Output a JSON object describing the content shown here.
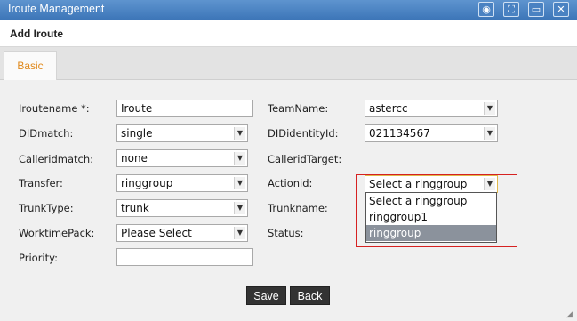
{
  "window": {
    "title": "Iroute Management",
    "buttons": [
      "◉",
      "⛶",
      "▭",
      "✕"
    ]
  },
  "header": {
    "title": "Add Iroute"
  },
  "tabs": [
    {
      "label": "Basic"
    }
  ],
  "form": {
    "left": [
      {
        "label": "Iroutename *:",
        "value": "Iroute",
        "type": "text"
      },
      {
        "label": "DIDmatch:",
        "value": "single",
        "type": "select"
      },
      {
        "label": "Calleridmatch:",
        "value": "none",
        "type": "select"
      },
      {
        "label": "Transfer:",
        "value": "ringgroup",
        "type": "select"
      },
      {
        "label": "TrunkType:",
        "value": "trunk",
        "type": "select"
      },
      {
        "label": "WorktimePack:",
        "value": "Please Select",
        "type": "select"
      },
      {
        "label": "Priority:",
        "value": "",
        "type": "text"
      }
    ],
    "right": [
      {
        "label": "TeamName:",
        "value": "astercc",
        "type": "select"
      },
      {
        "label": "DIDidentityId:",
        "value": "021134567",
        "type": "select"
      },
      {
        "label": "CalleridTarget:",
        "value": "",
        "type": "none"
      },
      {
        "label": "Actionid:",
        "value": "Select a ringgroup",
        "type": "select-open"
      },
      {
        "label": "Trunkname:",
        "value": "",
        "type": "none"
      },
      {
        "label": "Status:",
        "value": "",
        "type": "none"
      }
    ]
  },
  "dropdown": {
    "options": [
      "Select a ringgroup",
      "ringgroup1",
      "ringgroup"
    ],
    "highlighted_index": 2
  },
  "actions": {
    "save": "Save",
    "back": "Back"
  },
  "colors": {
    "titlebar": "#4a82c2",
    "tab_text": "#e08a1e",
    "highlight": "#8b929c",
    "callout": "#d62121"
  }
}
